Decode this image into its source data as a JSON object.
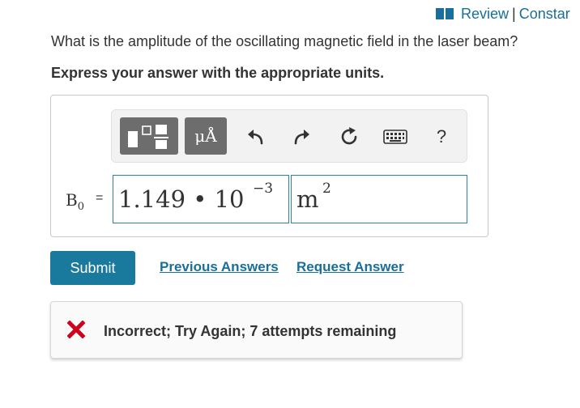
{
  "header": {
    "review_label": "Review",
    "separator": "|",
    "constants_label": "Constar"
  },
  "question": "What is the amplitude of the oscillating magnetic field in the laser beam?",
  "instruction": "Express your answer with the appropriate units.",
  "toolbar": {
    "units_label": "μÅ",
    "help_label": "?",
    "icons": [
      "templates-icon",
      "units-icon",
      "undo-icon",
      "redo-icon",
      "reset-icon",
      "keyboard-icon",
      "help-icon"
    ]
  },
  "answer": {
    "variable_label": "B",
    "variable_subscript": "0",
    "equals": "=",
    "value_mantissa": "1.149 • 10",
    "value_exponent": "−3",
    "units_base": "m",
    "units_exponent": "2"
  },
  "actions": {
    "submit_label": "Submit",
    "previous_answers_label": "Previous Answers",
    "request_answer_label": "Request Answer"
  },
  "feedback": {
    "status": "incorrect",
    "message": "Incorrect; Try Again; 7 attempts remaining"
  },
  "colors": {
    "accent": "#1a7a9e",
    "link": "#1a6e9a",
    "error": "#d0021b",
    "toolbar_button": "#6d6d6d"
  }
}
